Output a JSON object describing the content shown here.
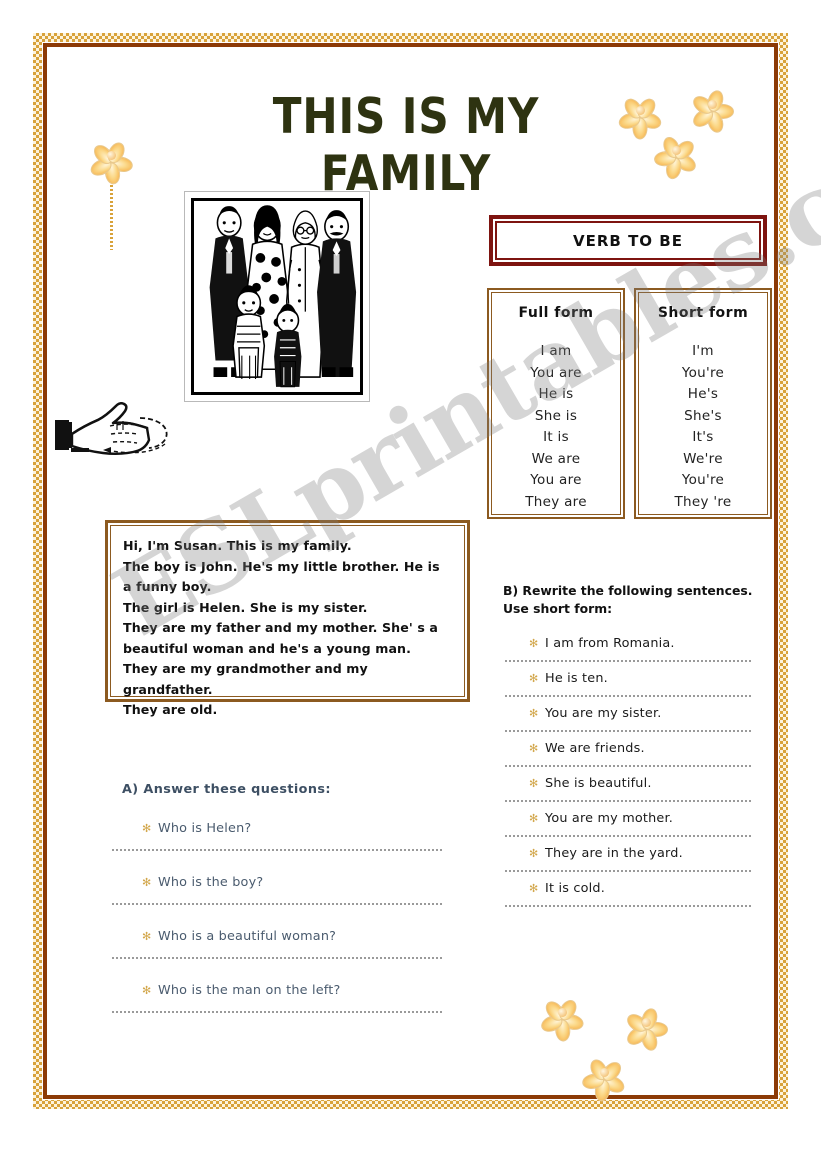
{
  "page": {
    "title": "THIS IS MY FAMILY",
    "watermark": "ESLprintables.com",
    "border_color": "#8c3a06",
    "border_accent_color": "#d8a23a",
    "title_color": "#2e3311"
  },
  "photo": {
    "alt_name": "family-photo",
    "description": "black and white line drawing of a family of six"
  },
  "hand": {
    "alt_name": "pointing-hand-illustration"
  },
  "verb_to_be": {
    "heading": "VERB TO BE",
    "heading_border_color": "#7e1410",
    "full_form": {
      "header": "Full form",
      "items": [
        "I am",
        "You are",
        "He is",
        "She is",
        "It is",
        "We are",
        "You are",
        "They are"
      ]
    },
    "short_form": {
      "header": "Short form",
      "items": [
        "I'm",
        "You're",
        "He's",
        "She's",
        "It's",
        "We're",
        "You're",
        "They 're"
      ]
    }
  },
  "passage": {
    "lines": [
      "Hi, I'm Susan. This is my family.",
      "The boy is John. He's my little brother. He is a funny boy.",
      "The girl is Helen. She is my sister.",
      "They are my father and my mother. She' s a beautiful woman and he's a young man.",
      "They are my grandmother and my grandfather.",
      "They are old."
    ]
  },
  "exercise_a": {
    "heading": "A)   Answer these questions:",
    "bullet_glyph": "✻",
    "text_color": "#4a5b6e",
    "questions": [
      "Who is Helen?",
      "Who is the boy?",
      "Who is a beautiful woman?",
      "Who is the man on the left?"
    ]
  },
  "exercise_b": {
    "heading_line1": "B) Rewrite the following sentences.",
    "heading_line2": "Use short form:",
    "bullet_glyph": "✻",
    "sentences": [
      "I am from Romania.",
      "He is ten.",
      "You are my sister.",
      "We are friends.",
      "She is beautiful.",
      "You are my mother.",
      "They are in the yard.",
      "It is cold."
    ]
  },
  "decorations": {
    "flower_color": "#f5a73a",
    "clusters": [
      {
        "name": "flower-cluster-top-right"
      },
      {
        "name": "flower-single-left"
      },
      {
        "name": "flower-cluster-bottom-right"
      }
    ]
  }
}
